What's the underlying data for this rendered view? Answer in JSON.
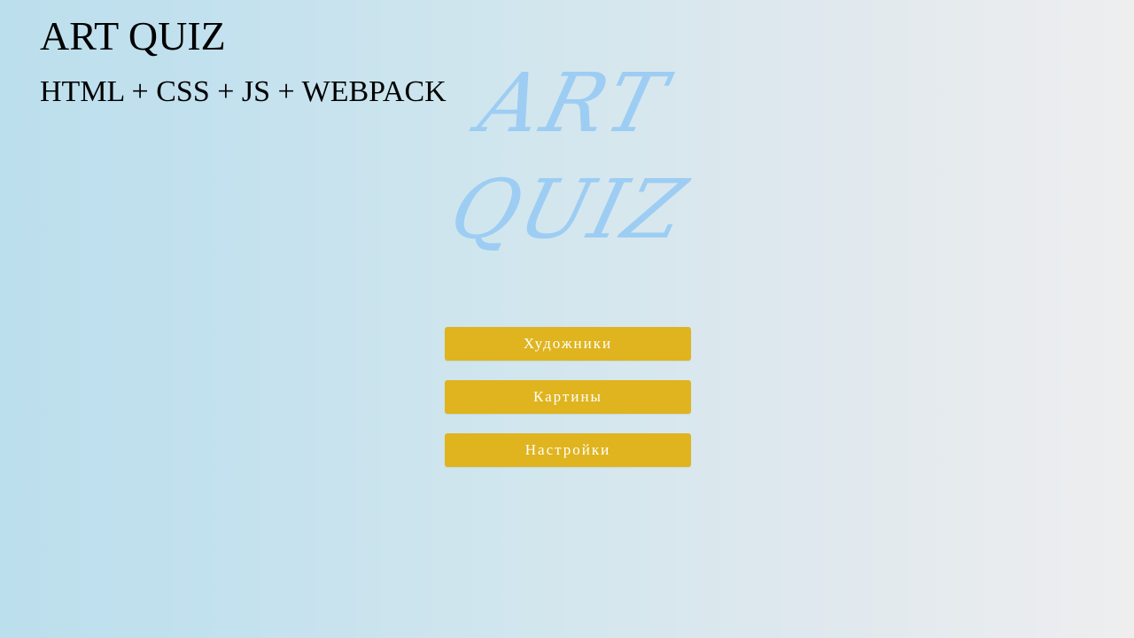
{
  "header": {
    "title": "ART QUIZ",
    "subtitle": "HTML + CSS + JS + WEBPACK"
  },
  "logo": {
    "line1": "ART",
    "line2": "QUIZ",
    "color": "#9dcdf3"
  },
  "menu": {
    "items": [
      {
        "label": "Художники"
      },
      {
        "label": "Картины"
      },
      {
        "label": "Настройки"
      }
    ],
    "button_color": "#dfb41f",
    "button_text_color": "#ffffff"
  }
}
